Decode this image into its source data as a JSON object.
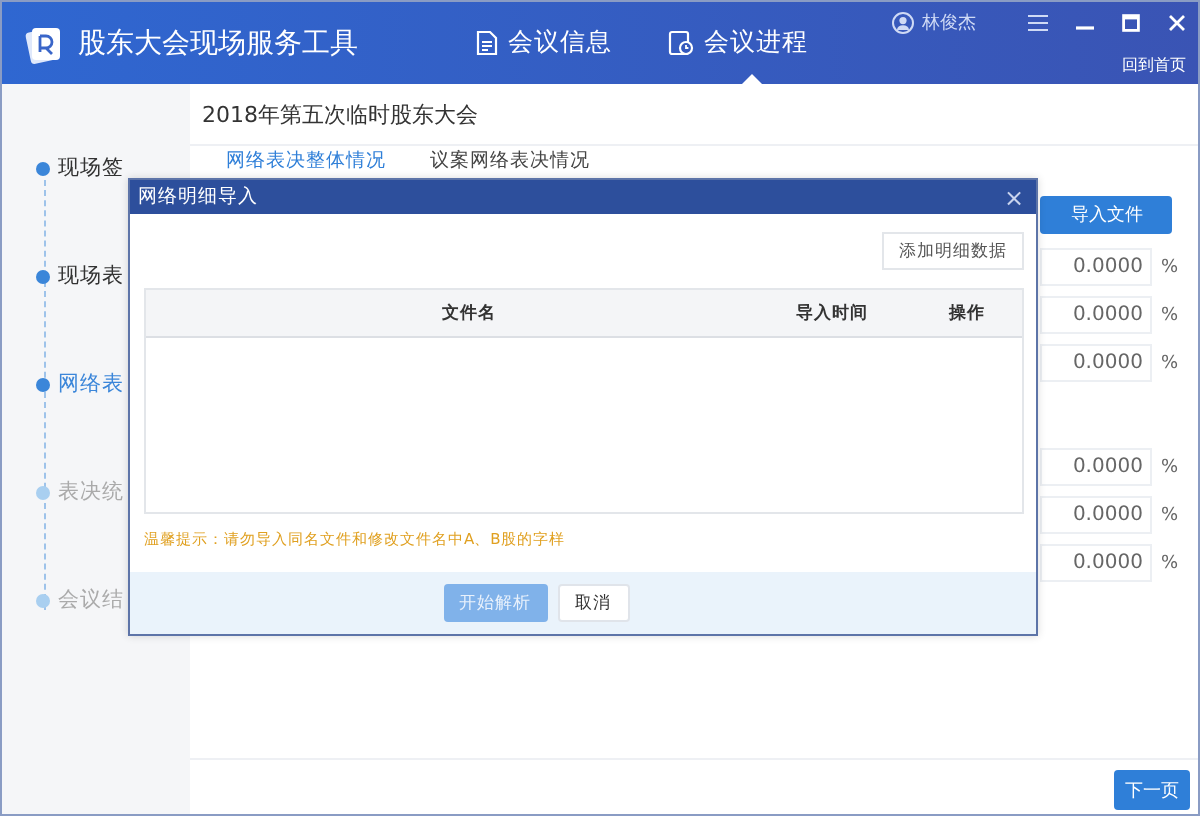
{
  "header": {
    "title": "股东大会现场服务工具",
    "nav": [
      {
        "label": "会议信息",
        "selected": false
      },
      {
        "label": "会议进程",
        "selected": true
      }
    ],
    "user": "林俊杰",
    "home_link": "回到首页"
  },
  "sidebar": {
    "steps": [
      {
        "label": "现场签",
        "kind": "done"
      },
      {
        "label": "现场表",
        "kind": "done"
      },
      {
        "label": "网络表",
        "kind": "current"
      },
      {
        "label": "表决统",
        "kind": "pending"
      },
      {
        "label": "会议结",
        "kind": "pending"
      }
    ]
  },
  "main": {
    "meeting_title": "2018年第五次临时股东大会",
    "tabs": [
      {
        "label": "网络表决整体情况",
        "selected": true
      },
      {
        "label": "议案网络表决情况",
        "selected": false
      }
    ],
    "import_button": "导入文件",
    "value_groups": [
      [
        {
          "value": "0.0000",
          "unit": "%"
        },
        {
          "value": "0.0000",
          "unit": "%"
        },
        {
          "value": "0.0000",
          "unit": "%"
        }
      ],
      [
        {
          "value": "0.0000",
          "unit": "%"
        },
        {
          "value": "0.0000",
          "unit": "%"
        },
        {
          "value": "0.0000",
          "unit": "%"
        }
      ]
    ],
    "next_button": "下一页"
  },
  "modal": {
    "title": "网络明细导入",
    "close": "×",
    "add_button": "添加明细数据",
    "table": {
      "columns": [
        {
          "label": "文件名",
          "kind": "name"
        },
        {
          "label": "导入时间",
          "kind": "time"
        },
        {
          "label": "操作",
          "kind": "action"
        }
      ]
    },
    "hint": "温馨提示：请勿导入同名文件和修改文件名中A、B股的字样",
    "buttons": [
      {
        "label": "开始解析",
        "kind": "primary",
        "disabled": true
      },
      {
        "label": "取消",
        "kind": "default",
        "disabled": false
      }
    ]
  }
}
